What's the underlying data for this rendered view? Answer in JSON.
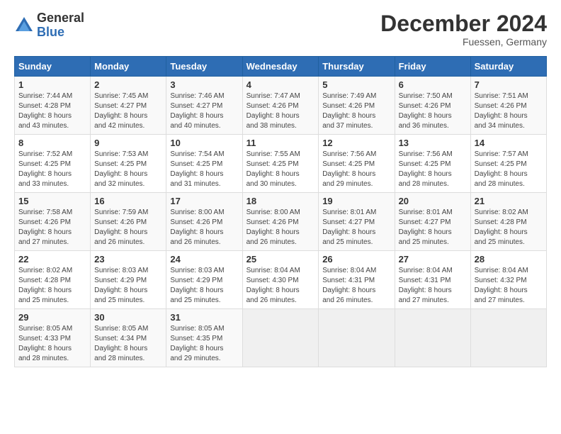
{
  "header": {
    "logo_general": "General",
    "logo_blue": "Blue",
    "month_title": "December 2024",
    "location": "Fuessen, Germany"
  },
  "calendar": {
    "days_of_week": [
      "Sunday",
      "Monday",
      "Tuesday",
      "Wednesday",
      "Thursday",
      "Friday",
      "Saturday"
    ],
    "weeks": [
      [
        {
          "day": "",
          "info": ""
        },
        {
          "day": "2",
          "info": "Sunrise: 7:45 AM\nSunset: 4:27 PM\nDaylight: 8 hours\nand 42 minutes."
        },
        {
          "day": "3",
          "info": "Sunrise: 7:46 AM\nSunset: 4:27 PM\nDaylight: 8 hours\nand 40 minutes."
        },
        {
          "day": "4",
          "info": "Sunrise: 7:47 AM\nSunset: 4:26 PM\nDaylight: 8 hours\nand 38 minutes."
        },
        {
          "day": "5",
          "info": "Sunrise: 7:49 AM\nSunset: 4:26 PM\nDaylight: 8 hours\nand 37 minutes."
        },
        {
          "day": "6",
          "info": "Sunrise: 7:50 AM\nSunset: 4:26 PM\nDaylight: 8 hours\nand 36 minutes."
        },
        {
          "day": "7",
          "info": "Sunrise: 7:51 AM\nSunset: 4:26 PM\nDaylight: 8 hours\nand 34 minutes."
        }
      ],
      [
        {
          "day": "1",
          "info": "Sunrise: 7:44 AM\nSunset: 4:28 PM\nDaylight: 8 hours\nand 43 minutes."
        },
        {
          "day": "8",
          "info": "Sunrise: 7:52 AM\nSunset: 4:25 PM\nDaylight: 8 hours\nand 33 minutes."
        },
        {
          "day": "9",
          "info": "Sunrise: 7:53 AM\nSunset: 4:25 PM\nDaylight: 8 hours\nand 32 minutes."
        },
        {
          "day": "10",
          "info": "Sunrise: 7:54 AM\nSunset: 4:25 PM\nDaylight: 8 hours\nand 31 minutes."
        },
        {
          "day": "11",
          "info": "Sunrise: 7:55 AM\nSunset: 4:25 PM\nDaylight: 8 hours\nand 30 minutes."
        },
        {
          "day": "12",
          "info": "Sunrise: 7:56 AM\nSunset: 4:25 PM\nDaylight: 8 hours\nand 29 minutes."
        },
        {
          "day": "13",
          "info": "Sunrise: 7:56 AM\nSunset: 4:25 PM\nDaylight: 8 hours\nand 28 minutes."
        },
        {
          "day": "14",
          "info": "Sunrise: 7:57 AM\nSunset: 4:25 PM\nDaylight: 8 hours\nand 28 minutes."
        }
      ],
      [
        {
          "day": "15",
          "info": "Sunrise: 7:58 AM\nSunset: 4:26 PM\nDaylight: 8 hours\nand 27 minutes."
        },
        {
          "day": "16",
          "info": "Sunrise: 7:59 AM\nSunset: 4:26 PM\nDaylight: 8 hours\nand 26 minutes."
        },
        {
          "day": "17",
          "info": "Sunrise: 8:00 AM\nSunset: 4:26 PM\nDaylight: 8 hours\nand 26 minutes."
        },
        {
          "day": "18",
          "info": "Sunrise: 8:00 AM\nSunset: 4:26 PM\nDaylight: 8 hours\nand 26 minutes."
        },
        {
          "day": "19",
          "info": "Sunrise: 8:01 AM\nSunset: 4:27 PM\nDaylight: 8 hours\nand 25 minutes."
        },
        {
          "day": "20",
          "info": "Sunrise: 8:01 AM\nSunset: 4:27 PM\nDaylight: 8 hours\nand 25 minutes."
        },
        {
          "day": "21",
          "info": "Sunrise: 8:02 AM\nSunset: 4:28 PM\nDaylight: 8 hours\nand 25 minutes."
        }
      ],
      [
        {
          "day": "22",
          "info": "Sunrise: 8:02 AM\nSunset: 4:28 PM\nDaylight: 8 hours\nand 25 minutes."
        },
        {
          "day": "23",
          "info": "Sunrise: 8:03 AM\nSunset: 4:29 PM\nDaylight: 8 hours\nand 25 minutes."
        },
        {
          "day": "24",
          "info": "Sunrise: 8:03 AM\nSunset: 4:29 PM\nDaylight: 8 hours\nand 25 minutes."
        },
        {
          "day": "25",
          "info": "Sunrise: 8:04 AM\nSunset: 4:30 PM\nDaylight: 8 hours\nand 26 minutes."
        },
        {
          "day": "26",
          "info": "Sunrise: 8:04 AM\nSunset: 4:31 PM\nDaylight: 8 hours\nand 26 minutes."
        },
        {
          "day": "27",
          "info": "Sunrise: 8:04 AM\nSunset: 4:31 PM\nDaylight: 8 hours\nand 27 minutes."
        },
        {
          "day": "28",
          "info": "Sunrise: 8:04 AM\nSunset: 4:32 PM\nDaylight: 8 hours\nand 27 minutes."
        }
      ],
      [
        {
          "day": "29",
          "info": "Sunrise: 8:05 AM\nSunset: 4:33 PM\nDaylight: 8 hours\nand 28 minutes."
        },
        {
          "day": "30",
          "info": "Sunrise: 8:05 AM\nSunset: 4:34 PM\nDaylight: 8 hours\nand 28 minutes."
        },
        {
          "day": "31",
          "info": "Sunrise: 8:05 AM\nSunset: 4:35 PM\nDaylight: 8 hours\nand 29 minutes."
        },
        {
          "day": "",
          "info": ""
        },
        {
          "day": "",
          "info": ""
        },
        {
          "day": "",
          "info": ""
        },
        {
          "day": "",
          "info": ""
        }
      ]
    ]
  }
}
